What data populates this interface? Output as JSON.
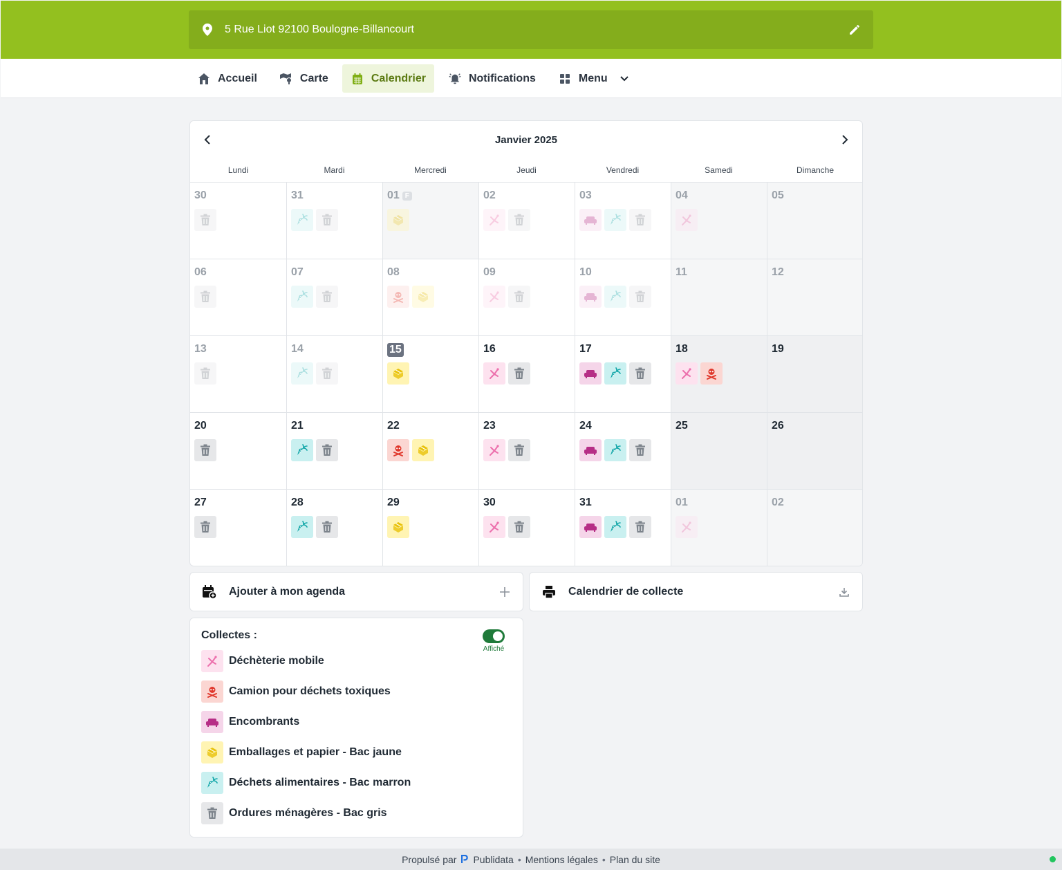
{
  "header": {
    "address": "5 Rue Liot 92100 Boulogne-Billancourt",
    "brand_color": "#93c01f"
  },
  "nav": [
    {
      "label": "Accueil",
      "icon": "home-icon"
    },
    {
      "label": "Carte",
      "icon": "map-icon"
    },
    {
      "label": "Calendrier",
      "icon": "calendar-icon",
      "active": true
    },
    {
      "label": "Notifications",
      "icon": "bell-icon"
    },
    {
      "label": "Menu",
      "icon": "grid-icon"
    }
  ],
  "calendar": {
    "title": "Janvier 2025",
    "weekdays": [
      "Lundi",
      "Mardi",
      "Mercredi",
      "Jeudi",
      "Vendredi",
      "Samedi",
      "Dimanche"
    ],
    "holiday_badge": "F",
    "weeks": [
      [
        {
          "day": "30",
          "muted": true,
          "items": [
            "gray"
          ],
          "faded": true
        },
        {
          "day": "31",
          "muted": true,
          "items": [
            "teal",
            "gray"
          ],
          "faded": true
        },
        {
          "day": "01",
          "muted": true,
          "items": [
            "yellow"
          ],
          "faded": true,
          "holiday": true,
          "shade": "light"
        },
        {
          "day": "02",
          "muted": true,
          "items": [
            "pink",
            "gray"
          ],
          "faded": true
        },
        {
          "day": "03",
          "muted": true,
          "items": [
            "purple",
            "teal",
            "gray"
          ],
          "faded": true
        },
        {
          "day": "04",
          "muted": true,
          "items": [
            "pink"
          ],
          "faded": true,
          "shade": "light"
        },
        {
          "day": "05",
          "muted": true,
          "items": [],
          "shade": "light"
        }
      ],
      [
        {
          "day": "06",
          "muted": true,
          "items": [
            "gray"
          ],
          "faded": true
        },
        {
          "day": "07",
          "muted": true,
          "items": [
            "teal",
            "gray"
          ],
          "faded": true
        },
        {
          "day": "08",
          "muted": true,
          "items": [
            "red",
            "yellow"
          ],
          "faded": true
        },
        {
          "day": "09",
          "muted": true,
          "items": [
            "pink",
            "gray"
          ],
          "faded": true
        },
        {
          "day": "10",
          "muted": true,
          "items": [
            "purple",
            "teal",
            "gray"
          ],
          "faded": true
        },
        {
          "day": "11",
          "muted": true,
          "items": [],
          "shade": "light"
        },
        {
          "day": "12",
          "muted": true,
          "items": [],
          "shade": "light"
        }
      ],
      [
        {
          "day": "13",
          "muted": true,
          "items": [
            "gray"
          ],
          "faded": true
        },
        {
          "day": "14",
          "muted": true,
          "items": [
            "teal",
            "gray"
          ],
          "faded": true
        },
        {
          "day": "15",
          "today": true,
          "items": [
            "yellow"
          ]
        },
        {
          "day": "16",
          "items": [
            "pink",
            "gray"
          ]
        },
        {
          "day": "17",
          "items": [
            "purple",
            "teal",
            "gray"
          ]
        },
        {
          "day": "18",
          "items": [
            "pink",
            "red"
          ],
          "shade": "dark"
        },
        {
          "day": "19",
          "items": [],
          "shade": "dark"
        }
      ],
      [
        {
          "day": "20",
          "items": [
            "gray"
          ]
        },
        {
          "day": "21",
          "items": [
            "teal",
            "gray"
          ]
        },
        {
          "day": "22",
          "items": [
            "red",
            "yellow"
          ]
        },
        {
          "day": "23",
          "items": [
            "pink",
            "gray"
          ]
        },
        {
          "day": "24",
          "items": [
            "purple",
            "teal",
            "gray"
          ]
        },
        {
          "day": "25",
          "items": [],
          "shade": "dark"
        },
        {
          "day": "26",
          "items": [],
          "shade": "dark"
        }
      ],
      [
        {
          "day": "27",
          "items": [
            "gray"
          ]
        },
        {
          "day": "28",
          "items": [
            "teal",
            "gray"
          ]
        },
        {
          "day": "29",
          "items": [
            "yellow"
          ]
        },
        {
          "day": "30",
          "items": [
            "pink",
            "gray"
          ]
        },
        {
          "day": "31",
          "items": [
            "purple",
            "teal",
            "gray"
          ]
        },
        {
          "day": "01",
          "muted": true,
          "items": [
            "pink"
          ],
          "faded": true,
          "shade": "light"
        },
        {
          "day": "02",
          "muted": true,
          "items": [],
          "shade": "light"
        }
      ]
    ]
  },
  "actions": {
    "add_agenda": "Ajouter à mon agenda",
    "download": "Calendrier de collecte"
  },
  "legend": {
    "title": "Collectes :",
    "toggle_label": "Affiché",
    "items": [
      {
        "type": "pink",
        "label": "Déchèterie mobile"
      },
      {
        "type": "red",
        "label": "Camion pour déchets toxiques"
      },
      {
        "type": "purple",
        "label": "Encombrants"
      },
      {
        "type": "yellow",
        "label": "Emballages et papier - Bac jaune"
      },
      {
        "type": "teal",
        "label": "Déchets alimentaires - Bac marron"
      },
      {
        "type": "gray",
        "label": "Ordures ménagères - Bac gris"
      }
    ]
  },
  "icon_names": {
    "pink": "mobile-recycling-icon",
    "red": "toxic-skull-icon",
    "purple": "sofa-icon",
    "yellow": "packaging-box-icon",
    "teal": "carrot-icon",
    "gray": "trash-icon"
  },
  "footer": {
    "powered": "Propulsé par",
    "brand": "Publidata",
    "legal": "Mentions légales",
    "sitemap": "Plan du site",
    "separator": "•"
  }
}
